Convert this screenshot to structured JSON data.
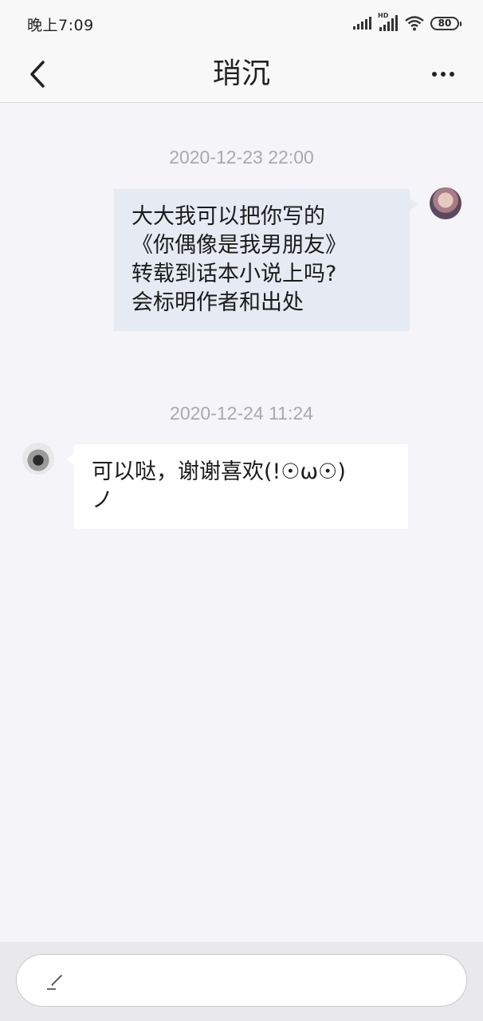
{
  "status_bar": {
    "time": "晚上7:09",
    "hd_label": "HD",
    "battery": "80",
    "icons": [
      "signal-icon",
      "hd-signal-icon",
      "wifi-icon",
      "battery-icon"
    ]
  },
  "nav": {
    "title": "琑沉",
    "back_icon": "chevron-left-icon",
    "more_icon": "more-dots-icon"
  },
  "messages": [
    {
      "timestamp": "2020-12-23 22:00",
      "sender": "me",
      "lines": [
        "大大我可以把你写的",
        "《你偶像是我男朋友》",
        "转载到话本小说上吗?",
        "会标明作者和出处"
      ]
    },
    {
      "timestamp": "2020-12-24 11:24",
      "sender": "other",
      "lines": [
        "可以哒，谢谢喜欢(!☉ω☉)",
        "ノ"
      ]
    }
  ],
  "input": {
    "icon": "pen-icon"
  },
  "colors": {
    "background": "#f4f4f9",
    "bubble_me": "#e5eaf3",
    "bubble_other": "#ffffff",
    "timestamp": "#aaaaaa"
  }
}
